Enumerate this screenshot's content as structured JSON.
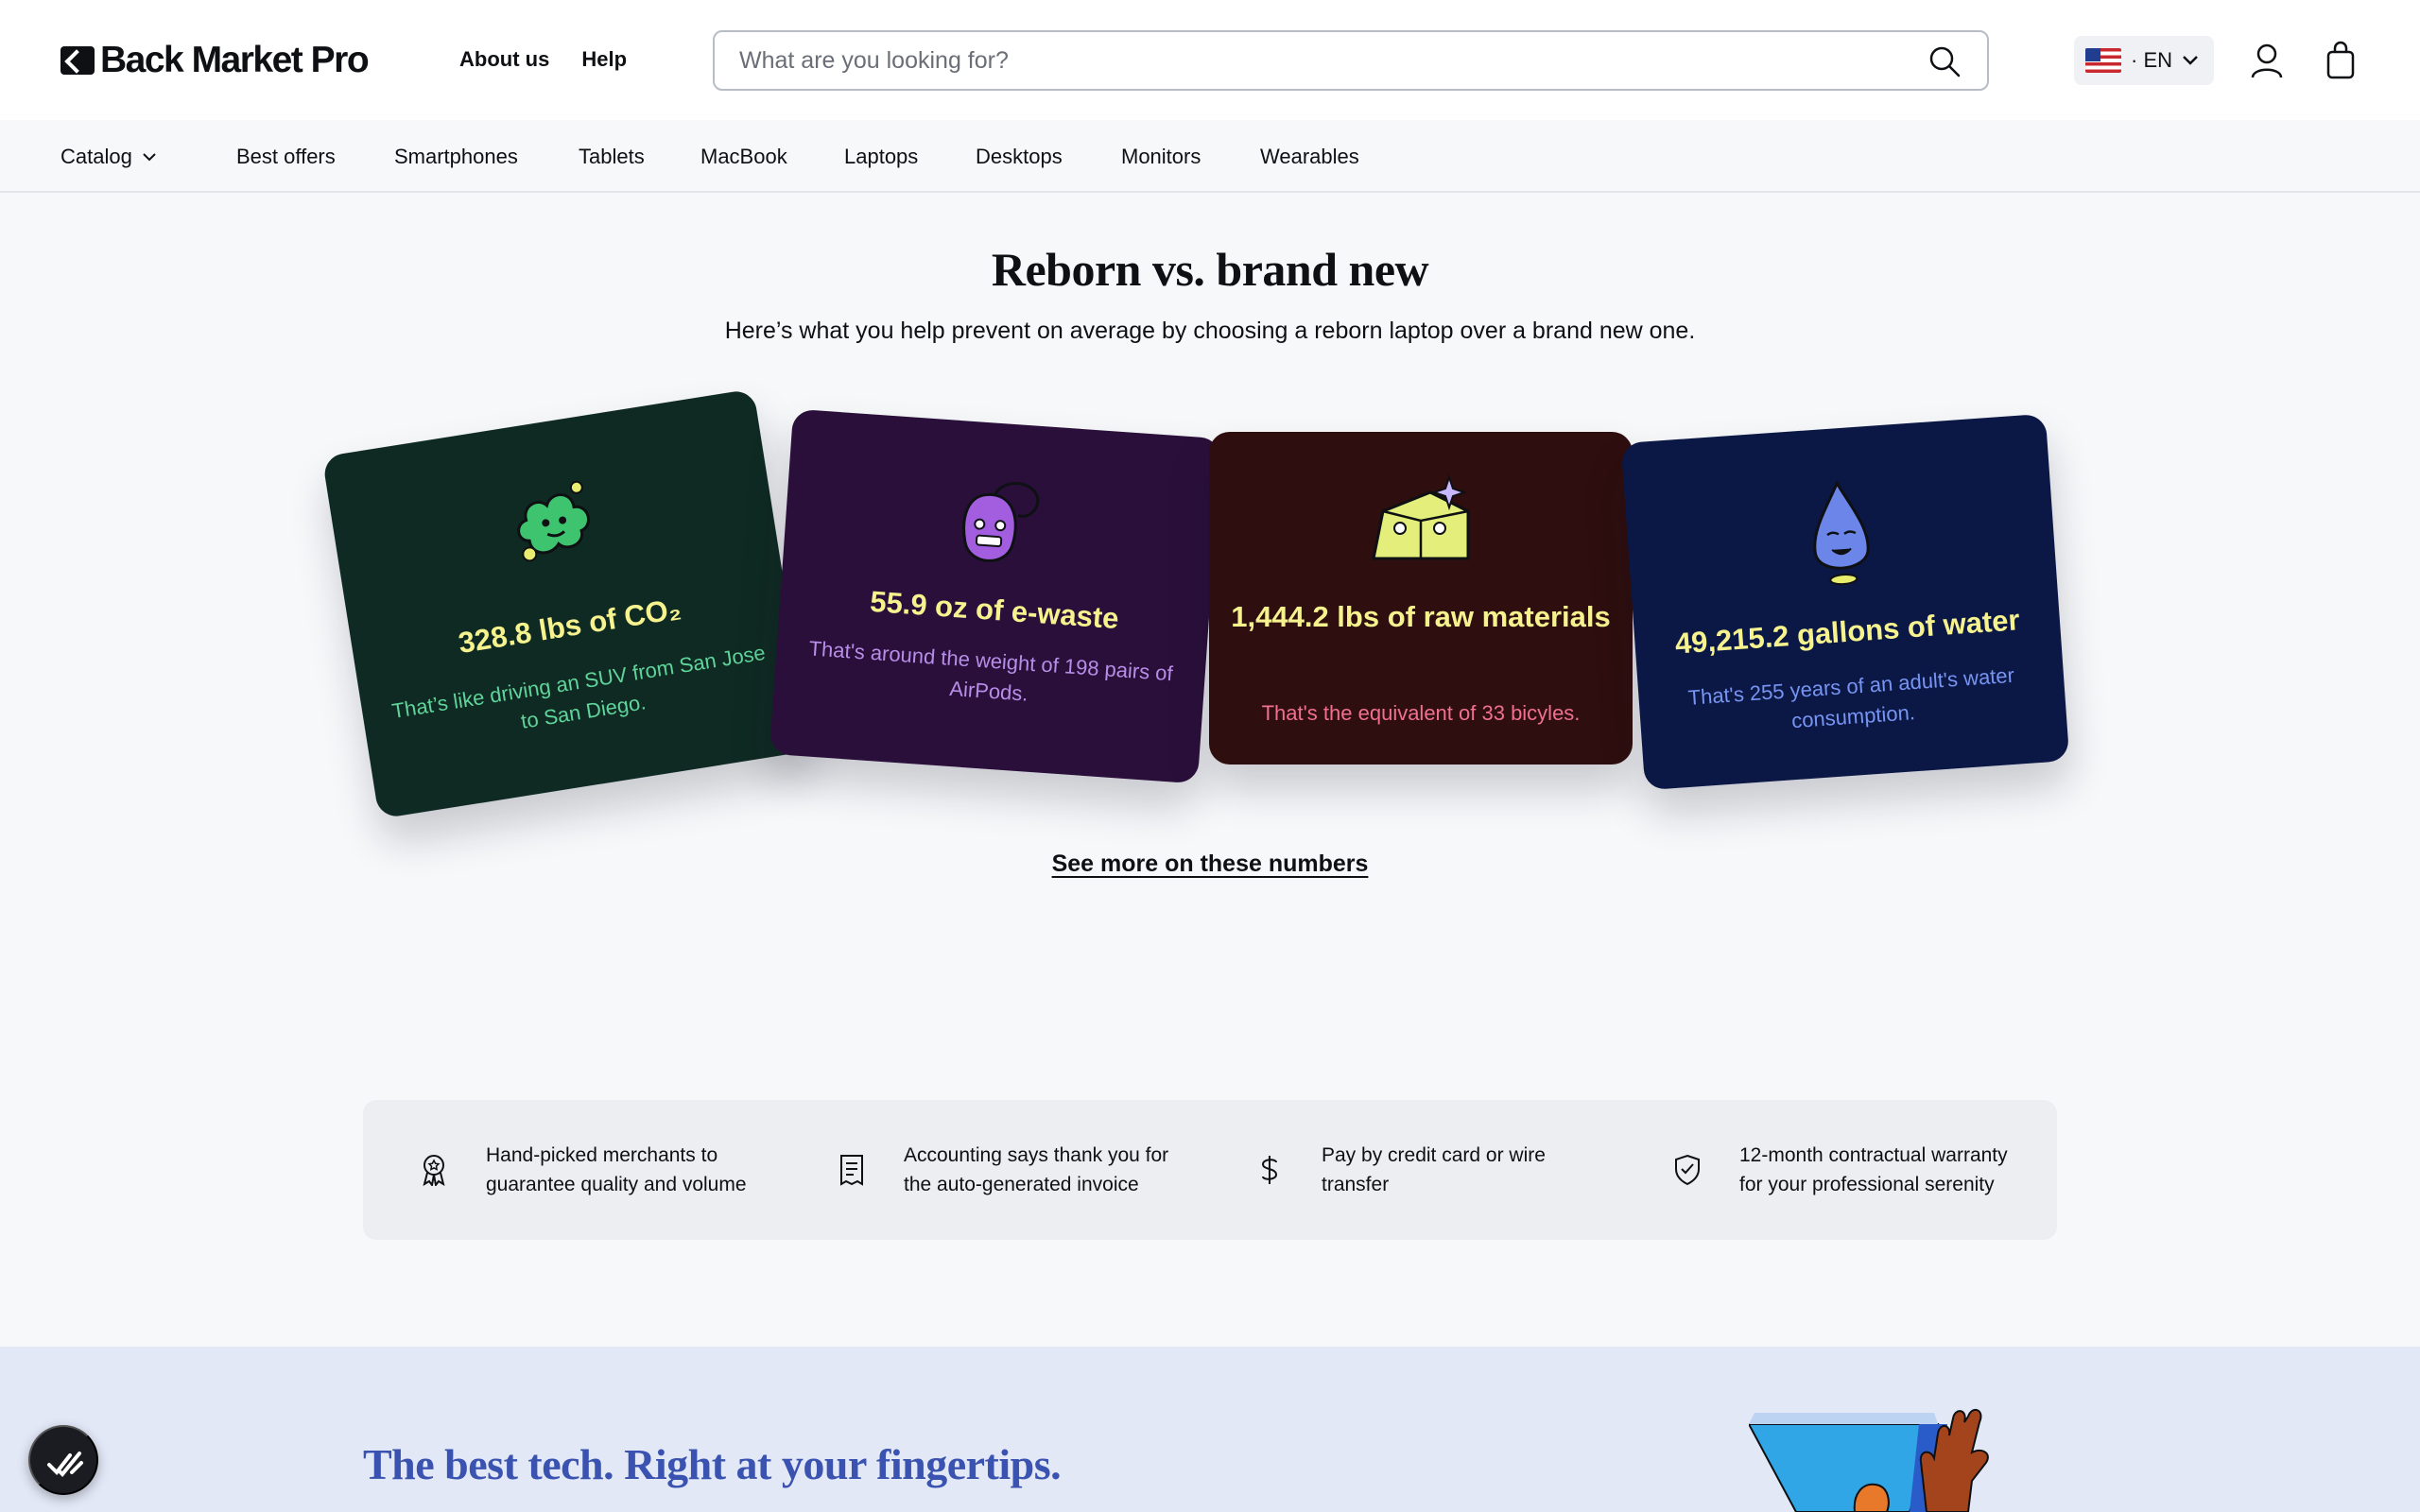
{
  "header": {
    "logo_text": "Back Market Pro",
    "links": [
      "About us",
      "Help"
    ],
    "search_placeholder": "What are you looking for?",
    "language": "· EN"
  },
  "nav": {
    "catalog": "Catalog",
    "items": [
      "Best offers",
      "Smartphones",
      "Tablets",
      "MacBook",
      "Laptops",
      "Desktops",
      "Monitors",
      "Wearables"
    ]
  },
  "impact": {
    "title": "Reborn vs. brand new",
    "subtitle": "Here’s what you help prevent on average by choosing a reborn laptop over a brand new one.",
    "cards": [
      {
        "value": "328.8 lbs of CO₂",
        "description": "That’s like driving an SUV from San Jose to San Diego.",
        "icon": "co2-cloud-icon"
      },
      {
        "value": "55.9 oz of e-waste",
        "description": "That's around the weight of 198 pairs of AirPods.",
        "icon": "mouse-icon"
      },
      {
        "value": "1,444.2 lbs of raw materials",
        "description": "That's the equivalent of 33 bicyles.",
        "icon": "raw-material-icon"
      },
      {
        "value": "49,215.2 gallons of water",
        "description": "That's 255 years of an adult's water consumption.",
        "icon": "water-drop-icon"
      }
    ],
    "link": "See more on these numbers"
  },
  "benefits": [
    {
      "text": "Hand-picked merchants to guarantee quality and volume",
      "icon": "award-icon"
    },
    {
      "text": "Accounting says thank you for the auto-generated invoice",
      "icon": "invoice-icon"
    },
    {
      "text": "Pay by credit card or wire transfer",
      "icon": "dollar-icon"
    },
    {
      "text": "12-month contractual warranty for your professional serenity",
      "icon": "shield-check-icon"
    }
  ],
  "bottom": {
    "title": "The best tech. Right at your fingertips."
  },
  "colors": {
    "accent_blue": "#3a52b0",
    "card_yellow": "#f6f38e"
  }
}
